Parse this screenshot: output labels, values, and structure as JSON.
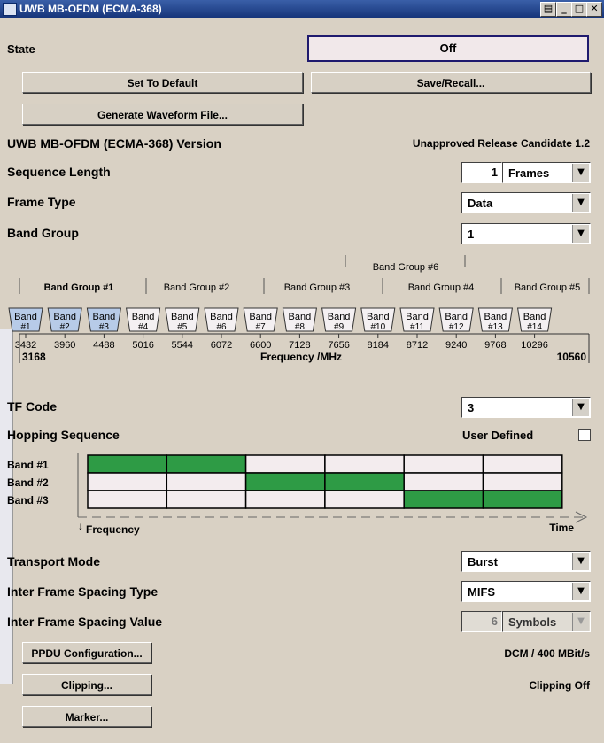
{
  "window": {
    "title": "UWB MB-OFDM (ECMA-368)"
  },
  "state": {
    "label": "State",
    "value": "Off"
  },
  "buttons": {
    "set_default": "Set To Default",
    "save_recall": "Save/Recall...",
    "generate_waveform": "Generate Waveform File...",
    "ppdu": "PPDU Configuration...",
    "clipping": "Clipping...",
    "marker": "Marker..."
  },
  "version": {
    "label": "UWB MB-OFDM (ECMA-368) Version",
    "value": "Unapproved Release Candidate 1.2"
  },
  "sequence_length": {
    "label": "Sequence Length",
    "value": "1",
    "unit": "Frames"
  },
  "frame_type": {
    "label": "Frame Type",
    "value": "Data"
  },
  "band_group": {
    "label": "Band Group",
    "value": "1"
  },
  "band_diagram": {
    "group6_label": "Band Group #6",
    "groups": [
      "Band Group #1",
      "Band Group #2",
      "Band Group #3",
      "Band Group #4",
      "Band Group #5"
    ],
    "band_word": "Band",
    "bands": [
      "#1",
      "#2",
      "#3",
      "#4",
      "#5",
      "#6",
      "#7",
      "#8",
      "#9",
      "#10",
      "#11",
      "#12",
      "#13",
      "#14"
    ],
    "selected_bands": 3,
    "ticks": [
      "3432",
      "3960",
      "4488",
      "5016",
      "5544",
      "6072",
      "6600",
      "7128",
      "7656",
      "8184",
      "8712",
      "9240",
      "9768",
      "10296"
    ],
    "freq_start": "3168",
    "freq_end": "10560",
    "axis_label": "Frequency /MHz"
  },
  "tf_code": {
    "label": "TF Code",
    "value": "3"
  },
  "hopping": {
    "label": "Hopping Sequence",
    "user_defined_label": "User Defined",
    "user_defined_checked": false,
    "rows": [
      "Band #1",
      "Band #2",
      "Band #3"
    ],
    "pattern": [
      [
        1,
        1,
        0,
        0,
        0,
        0
      ],
      [
        0,
        0,
        1,
        1,
        0,
        0
      ],
      [
        0,
        0,
        0,
        0,
        1,
        1
      ]
    ],
    "freq_label": "Frequency",
    "time_label": "Time",
    "colors": {
      "on": "#2e9b45",
      "off": "#f3ecee"
    }
  },
  "transport_mode": {
    "label": "Transport Mode",
    "value": "Burst"
  },
  "ifs_type": {
    "label": "Inter Frame Spacing Type",
    "value": "MIFS"
  },
  "ifs_value": {
    "label": "Inter Frame Spacing Value",
    "value": "6",
    "unit": "Symbols"
  },
  "ppdu_status": "DCM  /  400 MBit/s",
  "clipping_status": "Clipping Off",
  "colors": {
    "selected_band": "#b7cbe8",
    "band": "#f4f0f2",
    "title_bar": "#1c3d86"
  }
}
